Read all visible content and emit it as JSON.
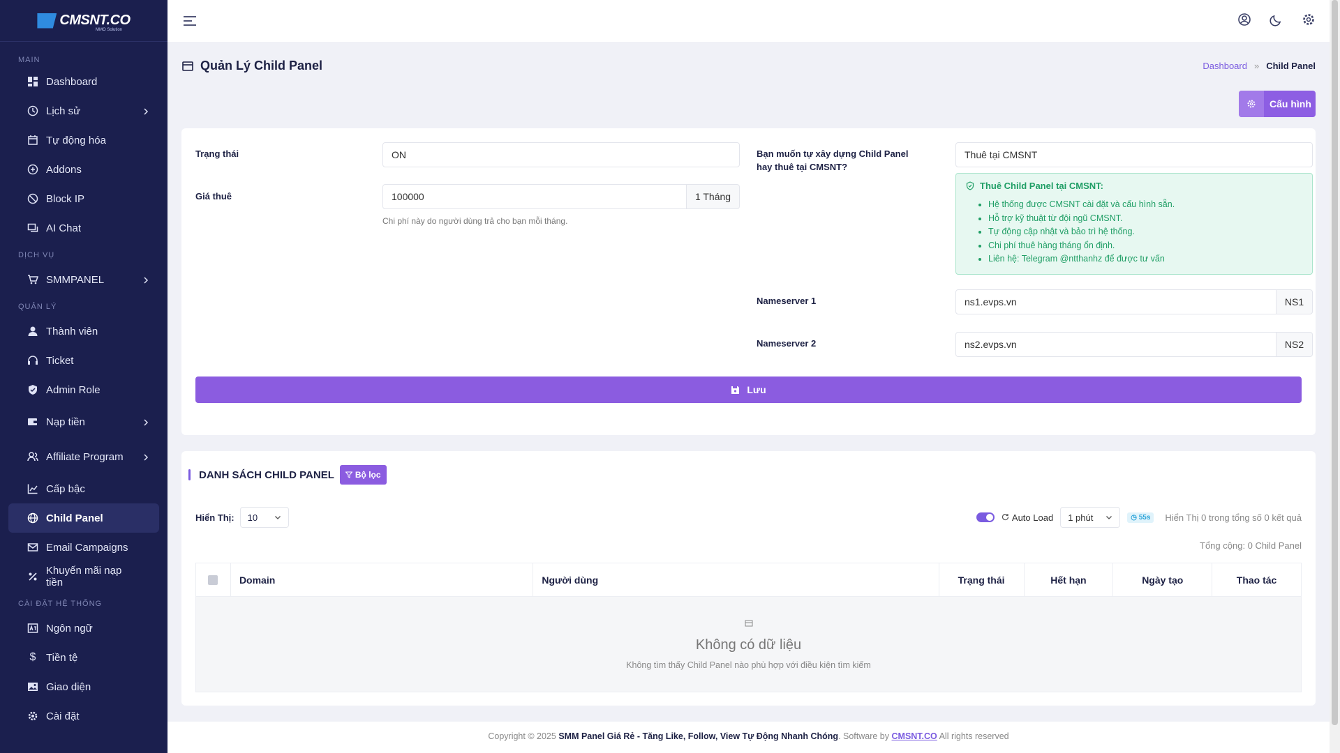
{
  "sidebar": {
    "logo_text": "CMSNT.CO",
    "logo_sub": "MMO Solution",
    "sections": {
      "main": "MAIN",
      "dich_vu": "DỊCH VỤ",
      "quan_ly": "QUẢN LÝ",
      "cai_dat": "CÀI ĐẶT HỆ THỐNG"
    },
    "items": [
      {
        "label": "Dashboard"
      },
      {
        "label": "Lịch sử"
      },
      {
        "label": "Tự động hóa"
      },
      {
        "label": "Addons"
      },
      {
        "label": "Block IP"
      },
      {
        "label": "AI Chat"
      },
      {
        "label": "SMMPANEL"
      },
      {
        "label": "Thành viên"
      },
      {
        "label": "Ticket"
      },
      {
        "label": "Admin Role"
      },
      {
        "label": "Nạp tiền"
      },
      {
        "label": "Affiliate Program"
      },
      {
        "label": "Cấp bậc"
      },
      {
        "label": "Child Panel"
      },
      {
        "label": "Email Campaigns"
      },
      {
        "label": "Khuyến mãi nạp tiền"
      },
      {
        "label": "Ngôn ngữ"
      },
      {
        "label": "Tiền tệ"
      },
      {
        "label": "Giao diện"
      },
      {
        "label": "Cài đặt"
      }
    ]
  },
  "page": {
    "title": "Quản Lý Child Panel",
    "breadcrumb": {
      "home": "Dashboard",
      "current": "Child Panel"
    },
    "config_button": "Cấu hình"
  },
  "form": {
    "status_label": "Trạng thái",
    "status_value": "ON",
    "price_label": "Giá thuê",
    "price_value": "100000",
    "price_unit": "1 Tháng",
    "price_hint": "Chi phí này do người dùng trả cho bạn mỗi tháng.",
    "mode_label": "Bạn muốn tự xây dựng Child Panel hay thuê tại CMSNT?",
    "mode_value": "Thuê tại CMSNT",
    "info_title": "Thuê Child Panel tại CMSNT:",
    "info_items": [
      "Hệ thống được CMSNT cài đặt và cấu hình sẵn.",
      "Hỗ trợ kỹ thuật từ đội ngũ CMSNT.",
      "Tự động cập nhật và bảo trì hệ thống.",
      "Chi phí thuê hàng tháng ổn định.",
      "Liên hệ: Telegram @ntthanhz để được tư vấn"
    ],
    "ns1_label": "Nameserver 1",
    "ns1_value": "ns1.evps.vn",
    "ns1_tag": "NS1",
    "ns2_label": "Nameserver 2",
    "ns2_value": "ns2.evps.vn",
    "ns2_tag": "NS2",
    "save_button": "Lưu"
  },
  "list": {
    "title": "DANH SÁCH CHILD PANEL",
    "filter_button": "Bộ lọc",
    "show_label": "Hiển Thị:",
    "show_value": "10",
    "autoload_label": "Auto Load",
    "interval_value": "1 phút",
    "countdown": "55s",
    "result_info": "Hiển Thị 0 trong tổng số 0 kết quả",
    "total": "Tổng cộng: 0 Child Panel",
    "columns": [
      "Domain",
      "Người dùng",
      "Trạng thái",
      "Hết hạn",
      "Ngày tạo",
      "Thao tác"
    ],
    "empty_title": "Không có dữ liệu",
    "empty_sub": "Không tìm thấy Child Panel nào phù hợp với điều kiện tìm kiếm"
  },
  "footer": {
    "prefix": "Copyright © 2025",
    "site": "SMM Panel Giá Rẻ - Tăng Like, Follow, View Tự Động Nhanh Chóng",
    "software_by": ". Software by",
    "brand": "CMSNT.CO",
    "suffix": "All rights reserved"
  },
  "colors": {
    "sidebar_bg": "#1b1f4e",
    "accent": "#8b5ce0",
    "success": "#1f9e65"
  }
}
